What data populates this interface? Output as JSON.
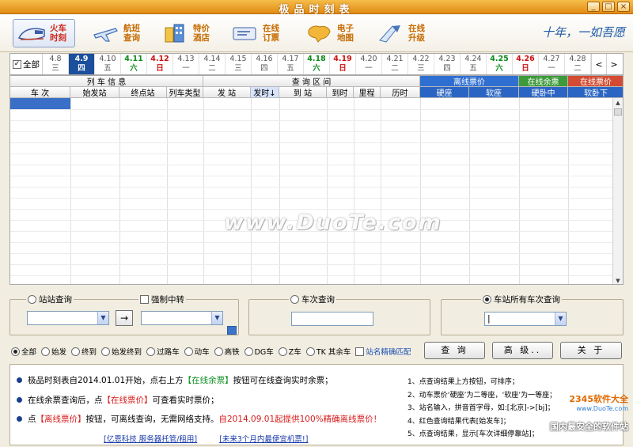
{
  "window": {
    "title": "极品时刻表",
    "minimize": "_",
    "restore": "□",
    "close": "×"
  },
  "toolbar": {
    "items": [
      {
        "label": "火车时刻",
        "icon": "train-icon",
        "active": true
      },
      {
        "label": "航班查询",
        "icon": "airplane-icon"
      },
      {
        "label": "特价酒店",
        "icon": "hotel-icon"
      },
      {
        "label": "在线订票",
        "icon": "ticket-icon"
      },
      {
        "label": "电子地图",
        "icon": "map-icon"
      },
      {
        "label": "在线升级",
        "icon": "upgrade-icon"
      }
    ],
    "slogan": "十年，一如吾愿"
  },
  "dates": {
    "all_label": "全部",
    "days": [
      {
        "date": "4.8",
        "wd": "三"
      },
      {
        "date": "4.9",
        "wd": "四",
        "selected": true
      },
      {
        "date": "4.10",
        "wd": "五"
      },
      {
        "date": "4.11",
        "wd": "六",
        "type": "sat"
      },
      {
        "date": "4.12",
        "wd": "日",
        "type": "sun"
      },
      {
        "date": "4.13",
        "wd": "一"
      },
      {
        "date": "4.14",
        "wd": "二"
      },
      {
        "date": "4.15",
        "wd": "三"
      },
      {
        "date": "4.16",
        "wd": "四"
      },
      {
        "date": "4.17",
        "wd": "五"
      },
      {
        "date": "4.18",
        "wd": "六",
        "type": "sat"
      },
      {
        "date": "4.19",
        "wd": "日",
        "type": "sun"
      },
      {
        "date": "4.20",
        "wd": "一"
      },
      {
        "date": "4.21",
        "wd": "二"
      },
      {
        "date": "4.22",
        "wd": "三"
      },
      {
        "date": "4.23",
        "wd": "四"
      },
      {
        "date": "4.24",
        "wd": "五"
      },
      {
        "date": "4.25",
        "wd": "六",
        "type": "sat"
      },
      {
        "date": "4.26",
        "wd": "日",
        "type": "sun"
      },
      {
        "date": "4.27",
        "wd": "一"
      },
      {
        "date": "4.28",
        "wd": "二"
      }
    ],
    "prev": "<",
    "next": ">"
  },
  "table": {
    "groups": {
      "train_info": "列 车 信 息",
      "query_range": "查 询 区 间",
      "offline_price": "离线票价",
      "online_remaining": "在线余票",
      "online_price": "在线票价"
    },
    "columns": {
      "train_no": "车 次",
      "origin": "始发站",
      "terminal": "终点站",
      "train_type": "列车类型",
      "depart_station": "发 站",
      "depart_time": "发时↓",
      "arrive_station": "到 站",
      "arrive_time": "到时",
      "distance": "里程",
      "duration": "历时",
      "hard_seat": "硬座",
      "soft_seat": "软座",
      "hard_sleeper_mid": "硬卧中",
      "soft_sleeper_low": "软卧下"
    },
    "watermark": "www.DuoTe.com"
  },
  "search": {
    "station_query": "站站查询",
    "force_transfer": "强制中转",
    "train_query": "车次查询",
    "station_all_trains": "车站所有车次查询",
    "station_all_value": "|",
    "swap": "→"
  },
  "filters": {
    "options": [
      "全部",
      "始发",
      "终到",
      "始发终到",
      "过路车",
      "动车",
      "高铁",
      "DG车",
      "Z车",
      "TK 其余车"
    ],
    "exact_match": "站名精确匹配"
  },
  "buttons": {
    "query": "查 询",
    "advanced": "高 级..",
    "about": "关 于"
  },
  "info": {
    "line1": {
      "a": "极品时刻表自2014.01.01开始，点右上方",
      "b": "【在线余票】",
      "c": "按钮可在线查询实时余票；"
    },
    "line2": {
      "a": "在线余票查询后，点",
      "b": "【在线票价】",
      "c": "可查看实时票价；"
    },
    "line3": {
      "a": "点",
      "b": "【离线票价】",
      "c": "按钮，可离线查询，无需网络支持。",
      "d": "自2014.09.01起提供100%精确离线票价！"
    },
    "tips": [
      "1、点查询结果上方按钮，可排序；",
      "2、动车票价‘硬座’为二等座，‘软座’为一等座；",
      "3、站名输入，拼音首字母，如:[北京]->[bj]；",
      "4、红色查询结果代表[始发车]；",
      "5、点查询结果，显示[车次详细停靠站]；"
    ],
    "links": [
      "[亿恩科技 服务器托管/租用]",
      "[未来3个月内最便宜机票!]"
    ]
  },
  "watermark2": {
    "brand": "2345软件大全",
    "url": "www.DuoTe.com",
    "caption": "国内最安全的软件站"
  }
}
